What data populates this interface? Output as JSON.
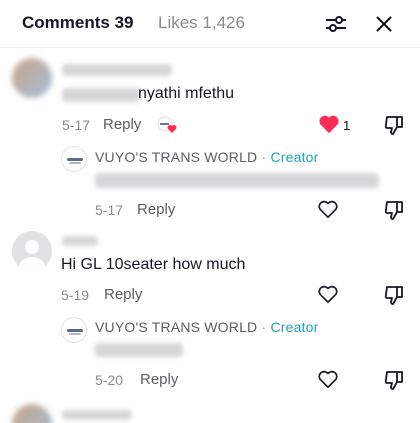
{
  "header": {
    "comments_tab": "Comments 39",
    "likes_tab": "Likes 1,426"
  },
  "comments": [
    {
      "text_visible": "nyathi mfethu",
      "date": "5-17",
      "reply_label": "Reply",
      "like_count": "1",
      "liked": true,
      "creator_reply": {
        "author": "VUYO'S TRANS WORLD",
        "separator": "·",
        "badge": "Creator",
        "date": "5-17",
        "reply_label": "Reply"
      }
    },
    {
      "text": "Hi GL 10seater how much",
      "date": "5-19",
      "reply_label": "Reply",
      "creator_reply": {
        "author": "VUYO'S TRANS WORLD",
        "separator": "·",
        "badge": "Creator",
        "date": "5-20",
        "reply_label": "Reply"
      }
    }
  ],
  "colors": {
    "creator_badge": "#20a1c1",
    "liked_heart": "#fe2c55"
  },
  "icons": [
    "filter-icon",
    "close-icon",
    "heart-icon",
    "dislike-icon",
    "default-avatar-icon"
  ]
}
